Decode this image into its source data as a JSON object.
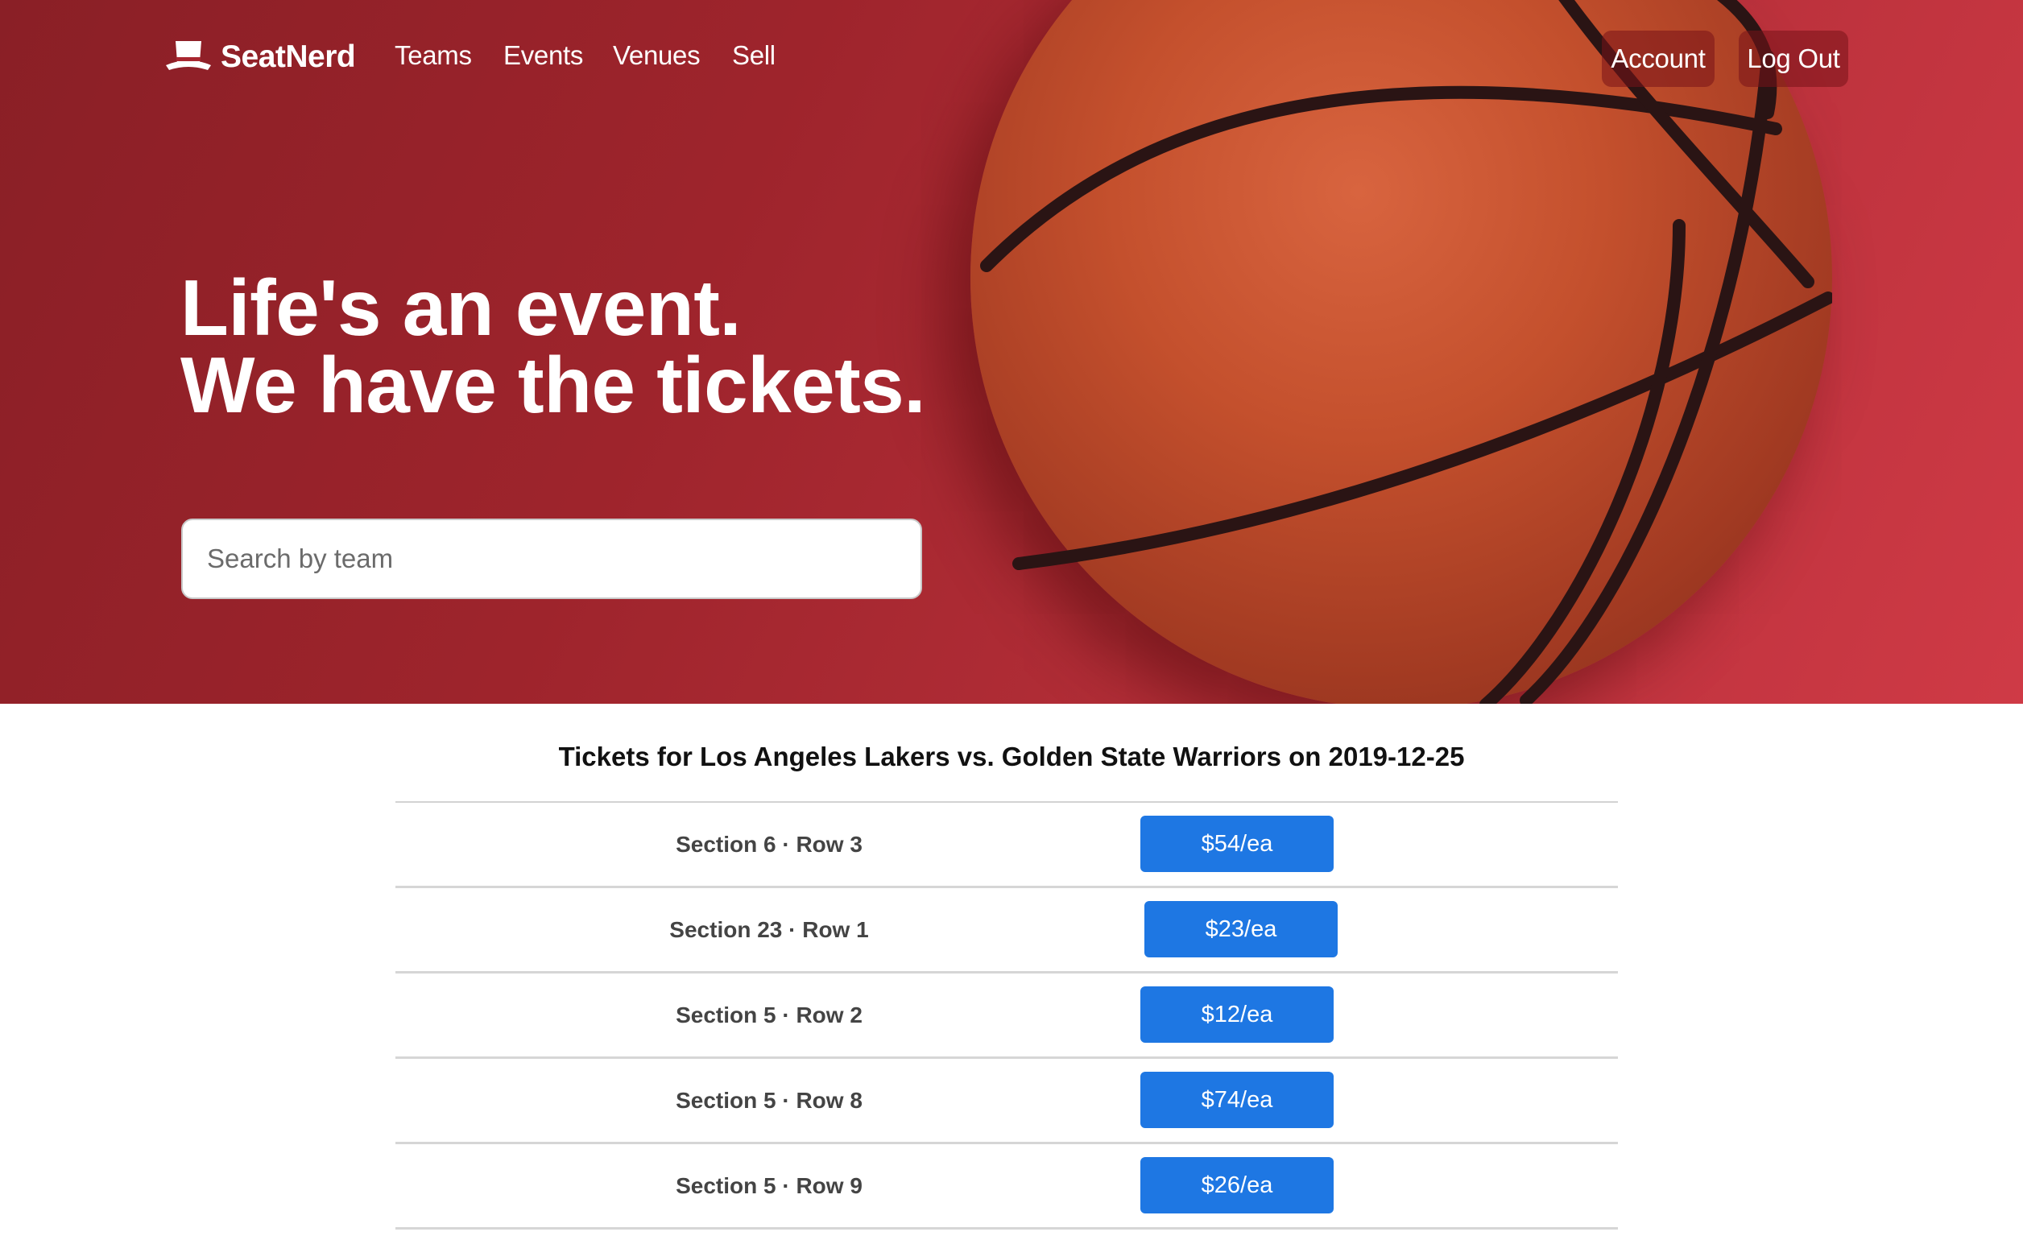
{
  "brand": {
    "name": "SeatNerd",
    "icon": "top-hat-icon"
  },
  "nav": {
    "links": [
      "Teams",
      "Events",
      "Venues",
      "Sell"
    ],
    "account_label": "Account",
    "logout_label": "Log Out"
  },
  "hero": {
    "headline_line1": "Life's an event.",
    "headline_line2": "We have the tickets.",
    "search_placeholder": "Search by team",
    "background_image": "basketball"
  },
  "tickets": {
    "title": "Tickets for Los Angeles Lakers vs. Golden State Warriors on 2019-12-25",
    "rows": [
      {
        "seat": "Section 6 · Row 3",
        "price": "$54/ea"
      },
      {
        "seat": "Section 23 · Row 1",
        "price": "$23/ea"
      },
      {
        "seat": "Section 5 · Row 2",
        "price": "$12/ea"
      },
      {
        "seat": "Section 5 · Row 8",
        "price": "$74/ea"
      },
      {
        "seat": "Section 5 · Row 9",
        "price": "$26/ea"
      }
    ]
  },
  "colors": {
    "hero_red": "#a8272f",
    "price_button": "#1e77e3",
    "nav_button_bg": "#7a1218"
  }
}
